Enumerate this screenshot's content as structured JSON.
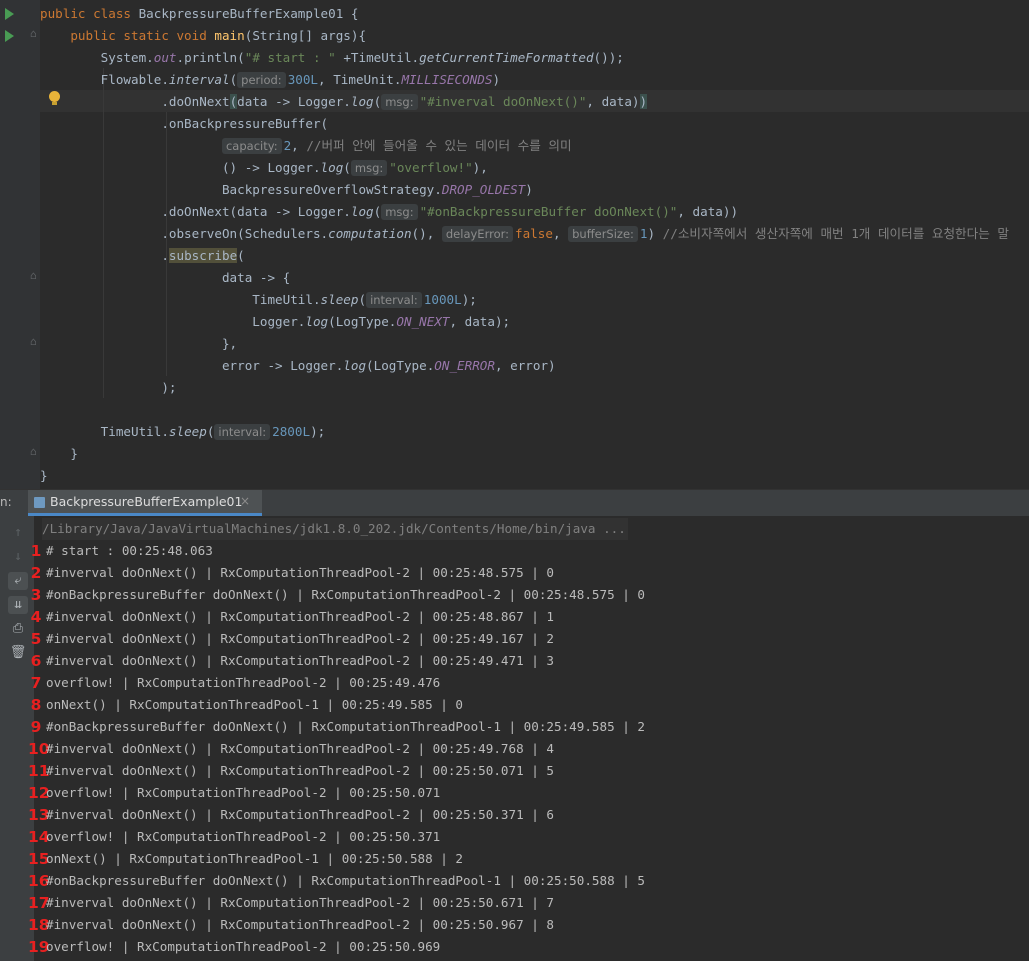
{
  "editor": {
    "lines": [
      [
        [
          "kw",
          "public class "
        ],
        [
          "",
          "BackpressureBufferExample01 {"
        ]
      ],
      [
        [
          "kw",
          "    public static void "
        ],
        [
          "method",
          "main"
        ],
        [
          "",
          "(String[] args){"
        ]
      ],
      [
        [
          "",
          "        System."
        ],
        [
          "static",
          "out"
        ],
        [
          "",
          ".println("
        ],
        [
          "str",
          "\"# start : \""
        ],
        [
          "",
          " +TimeUtil."
        ],
        [
          "italic",
          "getCurrentTimeFormatted"
        ],
        [
          "",
          "());"
        ]
      ],
      [
        [
          "",
          "        Flowable."
        ],
        [
          "italic",
          "interval"
        ],
        [
          "",
          "("
        ],
        [
          "hint",
          "period:"
        ],
        [
          "num",
          "300L"
        ],
        [
          "",
          ", TimeUnit."
        ],
        [
          "static",
          "MILLISECONDS"
        ],
        [
          "",
          ")"
        ]
      ],
      [
        [
          "",
          "                .doOnNext"
        ],
        [
          "brace",
          "("
        ],
        [
          "",
          "data -> Logger."
        ],
        [
          "italic",
          "log"
        ],
        [
          "",
          "("
        ],
        [
          "hint",
          "msg:"
        ],
        [
          "str",
          "\"#inverval doOnNext()\""
        ],
        [
          "",
          ", data)"
        ],
        [
          "brace",
          ")"
        ]
      ],
      [
        [
          "",
          "                .onBackpressureBuffer("
        ]
      ],
      [
        [
          "",
          "                        "
        ],
        [
          "hint",
          "capacity:"
        ],
        [
          "num",
          "2"
        ],
        [
          "",
          ", "
        ],
        [
          "cmt",
          "//버퍼 안에 들어올 수 있는 데이터 수를 의미"
        ]
      ],
      [
        [
          "",
          "                        () -> Logger."
        ],
        [
          "italic",
          "log"
        ],
        [
          "",
          "("
        ],
        [
          "hint",
          "msg:"
        ],
        [
          "str",
          "\"overflow!\""
        ],
        [
          "",
          "),"
        ]
      ],
      [
        [
          "",
          "                        BackpressureOverflowStrategy."
        ],
        [
          "static",
          "DROP_OLDEST"
        ],
        [
          "",
          ")"
        ]
      ],
      [
        [
          "",
          "                .doOnNext(data -> Logger."
        ],
        [
          "italic",
          "log"
        ],
        [
          "",
          "("
        ],
        [
          "hint",
          "msg:"
        ],
        [
          "str",
          "\"#onBackpressureBuffer doOnNext()\""
        ],
        [
          "",
          ", data))"
        ]
      ],
      [
        [
          "",
          "                .observeOn(Schedulers."
        ],
        [
          "italic",
          "computation"
        ],
        [
          "",
          "(), "
        ],
        [
          "hint",
          "delayError:"
        ],
        [
          "kw",
          "false"
        ],
        [
          "",
          ", "
        ],
        [
          "hint",
          "bufferSize:"
        ],
        [
          "num",
          "1"
        ],
        [
          "",
          ") "
        ],
        [
          "cmt",
          "//소비자쪽에서 생산자쪽에 매번 1개 데이터를 요청한다는 말"
        ]
      ],
      [
        [
          "",
          "                ."
        ],
        [
          "sub",
          "subscribe"
        ],
        [
          "",
          "("
        ]
      ],
      [
        [
          "",
          "                        data -> {"
        ]
      ],
      [
        [
          "",
          "                            TimeUtil."
        ],
        [
          "italic",
          "sleep"
        ],
        [
          "",
          "("
        ],
        [
          "hint",
          "interval:"
        ],
        [
          "num",
          "1000L"
        ],
        [
          "",
          ");"
        ]
      ],
      [
        [
          "",
          "                            Logger."
        ],
        [
          "italic",
          "log"
        ],
        [
          "",
          "(LogType."
        ],
        [
          "static",
          "ON_NEXT"
        ],
        [
          "",
          ", data);"
        ]
      ],
      [
        [
          "",
          "                        },"
        ]
      ],
      [
        [
          "",
          "                        error -> Logger."
        ],
        [
          "italic",
          "log"
        ],
        [
          "",
          "(LogType."
        ],
        [
          "static",
          "ON_ERROR"
        ],
        [
          "",
          ", error)"
        ]
      ],
      [
        [
          "",
          "                );"
        ]
      ],
      [
        [
          "",
          ""
        ]
      ],
      [
        [
          "",
          "        TimeUtil."
        ],
        [
          "italic",
          "sleep"
        ],
        [
          "",
          "("
        ],
        [
          "hint",
          "interval:"
        ],
        [
          "num",
          "2800L"
        ],
        [
          "",
          ");"
        ]
      ],
      [
        [
          "",
          "    }"
        ]
      ],
      [
        [
          "",
          "}"
        ]
      ]
    ]
  },
  "run_panel": {
    "label": "n:",
    "tab_label": "BackpressureBufferExample01",
    "tab_close": "×",
    "command": "/Library/Java/JavaVirtualMachines/jdk1.8.0_202.jdk/Contents/Home/bin/java ...",
    "output": [
      {
        "n": "1",
        "text": "# start : 00:25:48.063"
      },
      {
        "n": "2",
        "text": "#inverval doOnNext() | RxComputationThreadPool-2 | 00:25:48.575 | 0"
      },
      {
        "n": "3",
        "text": "#onBackpressureBuffer doOnNext() | RxComputationThreadPool-2 | 00:25:48.575 | 0"
      },
      {
        "n": "4",
        "text": "#inverval doOnNext() | RxComputationThreadPool-2 | 00:25:48.867 | 1"
      },
      {
        "n": "5",
        "text": "#inverval doOnNext() | RxComputationThreadPool-2 | 00:25:49.167 | 2"
      },
      {
        "n": "6",
        "text": "#inverval doOnNext() | RxComputationThreadPool-2 | 00:25:49.471 | 3"
      },
      {
        "n": "7",
        "text": "overflow! | RxComputationThreadPool-2 | 00:25:49.476"
      },
      {
        "n": "8",
        "text": "onNext() | RxComputationThreadPool-1 | 00:25:49.585 | 0"
      },
      {
        "n": "9",
        "text": "#onBackpressureBuffer doOnNext() | RxComputationThreadPool-1 | 00:25:49.585 | 2"
      },
      {
        "n": "10",
        "text": "#inverval doOnNext() | RxComputationThreadPool-2 | 00:25:49.768 | 4"
      },
      {
        "n": "11",
        "text": "#inverval doOnNext() | RxComputationThreadPool-2 | 00:25:50.071 | 5"
      },
      {
        "n": "12",
        "text": "overflow! | RxComputationThreadPool-2 | 00:25:50.071"
      },
      {
        "n": "13",
        "text": "#inverval doOnNext() | RxComputationThreadPool-2 | 00:25:50.371 | 6"
      },
      {
        "n": "14",
        "text": "overflow! | RxComputationThreadPool-2 | 00:25:50.371"
      },
      {
        "n": "15",
        "text": "onNext() | RxComputationThreadPool-1 | 00:25:50.588 | 2"
      },
      {
        "n": "16",
        "text": "#onBackpressureBuffer doOnNext() | RxComputationThreadPool-1 | 00:25:50.588 | 5"
      },
      {
        "n": "17",
        "text": "#inverval doOnNext() | RxComputationThreadPool-2 | 00:25:50.671 | 7"
      },
      {
        "n": "18",
        "text": "#inverval doOnNext() | RxComputationThreadPool-2 | 00:25:50.967 | 8"
      },
      {
        "n": "19",
        "text": "overflow! | RxComputationThreadPool-2 | 00:25:50.969"
      }
    ],
    "tools": [
      {
        "name": "scroll-up-icon",
        "glyph": "↑",
        "active": false,
        "dim": true
      },
      {
        "name": "scroll-down-icon",
        "glyph": "↓",
        "active": false,
        "dim": true
      },
      {
        "name": "soft-wrap-icon",
        "glyph": "⤶",
        "active": true,
        "dim": false
      },
      {
        "name": "scroll-to-end-icon",
        "glyph": "⇊",
        "active": true,
        "dim": false
      },
      {
        "name": "print-icon",
        "glyph": "⎙",
        "active": false,
        "dim": false
      },
      {
        "name": "trash-icon",
        "glyph": "🗑",
        "active": false,
        "dim": false
      }
    ]
  }
}
